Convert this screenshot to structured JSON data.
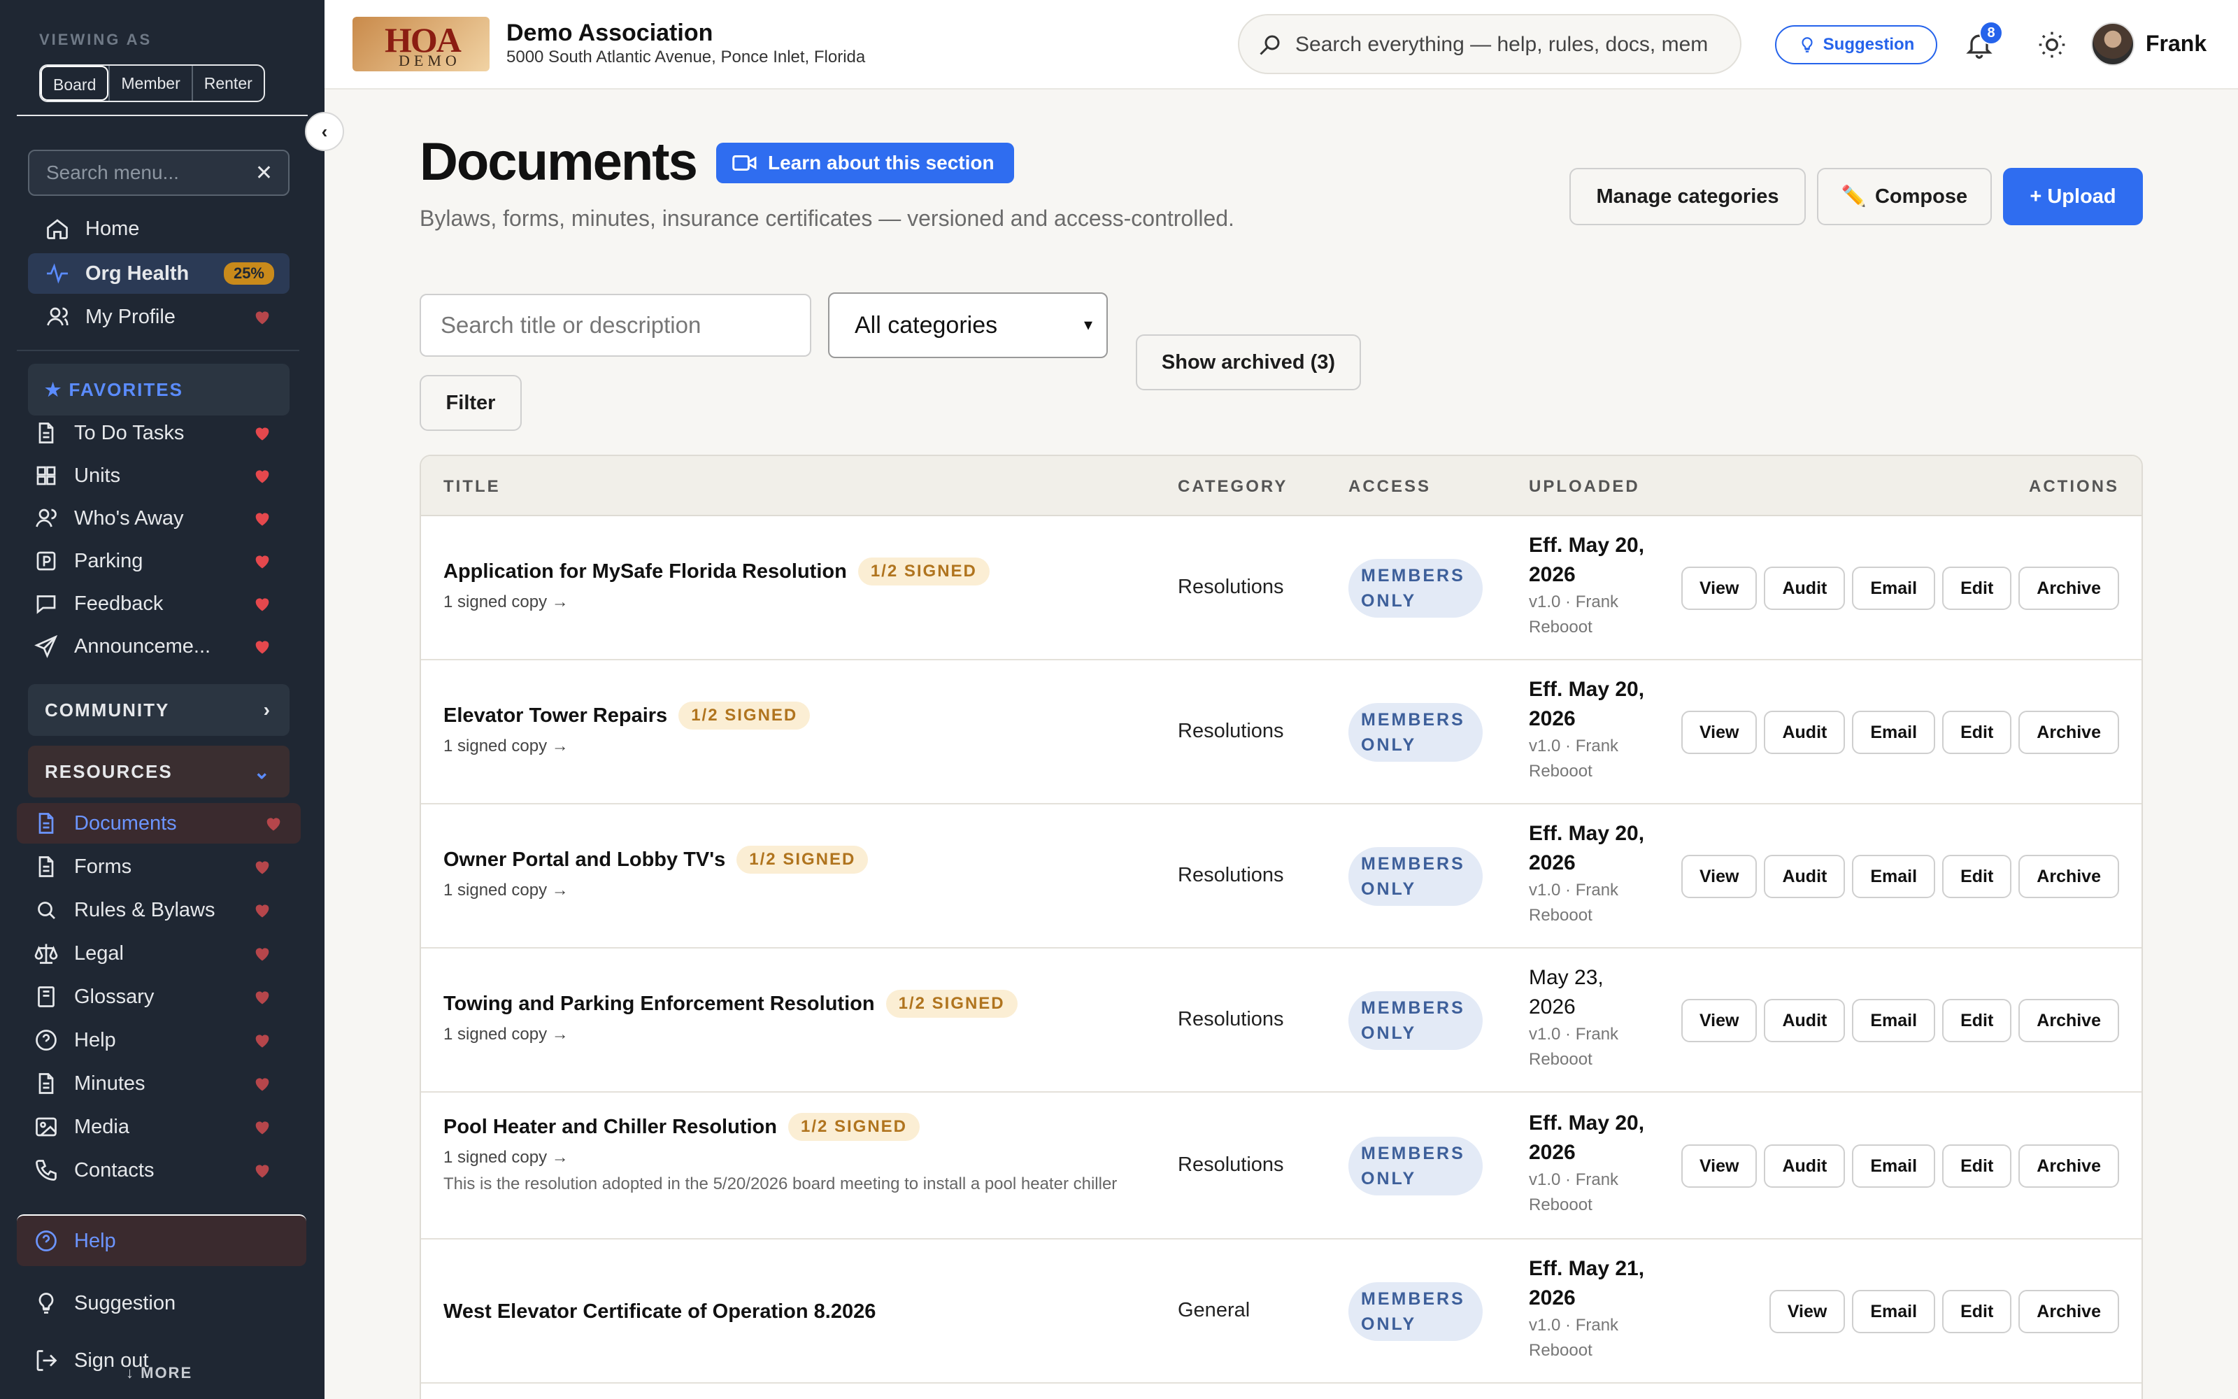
{
  "sidebar": {
    "viewing_as_label": "VIEWING AS",
    "roles": [
      "Board",
      "Member",
      "Renter"
    ],
    "search_placeholder": "Search menu...",
    "main_items": [
      {
        "label": "Home",
        "icon": "home-icon"
      },
      {
        "label": "Org Health",
        "icon": "pulse-icon",
        "badge": "25%"
      },
      {
        "label": "My Profile",
        "icon": "user-icon"
      }
    ],
    "favorites_label": "FAVORITES",
    "favorites": [
      {
        "label": "To Do Tasks",
        "icon": "document-icon"
      },
      {
        "label": "Units",
        "icon": "grid-icon"
      },
      {
        "label": "Who's Away",
        "icon": "users-icon"
      },
      {
        "label": "Parking",
        "icon": "parking-icon"
      },
      {
        "label": "Feedback",
        "icon": "chat-icon"
      },
      {
        "label": "Announceme...",
        "icon": "send-icon"
      }
    ],
    "community_label": "COMMUNITY",
    "resources_label": "RESOURCES",
    "resources": [
      {
        "label": "Documents",
        "icon": "document-icon"
      },
      {
        "label": "Forms",
        "icon": "document-icon"
      },
      {
        "label": "Rules & Bylaws",
        "icon": "search-icon"
      },
      {
        "label": "Legal",
        "icon": "scale-icon"
      },
      {
        "label": "Glossary",
        "icon": "book-icon"
      },
      {
        "label": "Help",
        "icon": "help-icon"
      },
      {
        "label": "Minutes",
        "icon": "document-icon"
      },
      {
        "label": "Media",
        "icon": "image-icon"
      },
      {
        "label": "Contacts",
        "icon": "phone-icon"
      }
    ],
    "bottom": {
      "help": "Help",
      "suggestion": "Suggestion",
      "sign_out": "Sign out",
      "more": "↓ MORE"
    }
  },
  "header": {
    "logo_top": "HOA",
    "logo_bottom": "DEMO",
    "org_name": "Demo Association",
    "org_address": "5000 South Atlantic Avenue, Ponce Inlet, Florida",
    "search_placeholder": "Search everything — help, rules, docs, members",
    "suggestion_label": "Suggestion",
    "notification_count": "8",
    "user_name": "Frank"
  },
  "page": {
    "title": "Documents",
    "learn_label": "Learn about this section",
    "subtitle": "Bylaws, forms, minutes, insurance certificates — versioned and access-controlled.",
    "buttons": {
      "manage": "Manage categories",
      "compose": "Compose",
      "upload": "+ Upload"
    },
    "filters": {
      "search_placeholder": "Search title or description",
      "category_value": "All categories",
      "show_archived": "Show archived (3)",
      "filter": "Filter"
    }
  },
  "table": {
    "columns": {
      "title": "TITLE",
      "category": "CATEGORY",
      "access": "ACCESS",
      "uploaded": "UPLOADED",
      "actions": "ACTIONS"
    },
    "rows": [
      {
        "title": "Application for MySafe Florida Resolution",
        "signed": "1/2 SIGNED",
        "sub": "1 signed copy →",
        "desc": "",
        "category": "Resolutions",
        "access": "MEMBERS ONLY",
        "date_line1": "Eff. May 20,",
        "date_line2": "2026",
        "meta1": "v1.0 · Frank",
        "meta2": "Rebooot",
        "actions": [
          "View",
          "Audit",
          "Email",
          "Edit",
          "Archive"
        ]
      },
      {
        "title": "Elevator Tower Repairs",
        "signed": "1/2 SIGNED",
        "sub": "1 signed copy →",
        "desc": "",
        "category": "Resolutions",
        "access": "MEMBERS ONLY",
        "date_line1": "Eff. May 20,",
        "date_line2": "2026",
        "meta1": "v1.0 · Frank",
        "meta2": "Rebooot",
        "actions": [
          "View",
          "Audit",
          "Email",
          "Edit",
          "Archive"
        ]
      },
      {
        "title": "Owner Portal and Lobby TV's",
        "signed": "1/2 SIGNED",
        "sub": "1 signed copy →",
        "desc": "",
        "category": "Resolutions",
        "access": "MEMBERS ONLY",
        "date_line1": "Eff. May 20,",
        "date_line2": "2026",
        "meta1": "v1.0 · Frank",
        "meta2": "Rebooot",
        "actions": [
          "View",
          "Audit",
          "Email",
          "Edit",
          "Archive"
        ]
      },
      {
        "title": "Towing and Parking Enforcement Resolution",
        "signed": "1/2 SIGNED",
        "sub": "1 signed copy →",
        "desc": "",
        "category": "Resolutions",
        "access": "MEMBERS ONLY",
        "date_line1": "May 23,",
        "date_line2": "2026",
        "meta1": "v1.0 · Frank",
        "meta2": "Rebooot",
        "actions": [
          "View",
          "Audit",
          "Email",
          "Edit",
          "Archive"
        ]
      },
      {
        "title": "Pool Heater and Chiller Resolution",
        "signed": "1/2 SIGNED",
        "sub": "1 signed copy →",
        "desc": "This is the resolution adopted in the 5/20/2026 board meeting to install a pool heater chiller",
        "category": "Resolutions",
        "access": "MEMBERS ONLY",
        "date_line1": "Eff. May 20,",
        "date_line2": "2026",
        "meta1": "v1.0 · Frank",
        "meta2": "Rebooot",
        "actions": [
          "View",
          "Audit",
          "Email",
          "Edit",
          "Archive"
        ]
      },
      {
        "title": "West Elevator Certificate of Operation 8.2026",
        "signed": "",
        "sub": "",
        "desc": "",
        "category": "General",
        "access": "MEMBERS ONLY",
        "date_line1": "Eff. May 21,",
        "date_line2": "2026",
        "meta1": "v1.0 · Frank",
        "meta2": "Rebooot",
        "actions": [
          "View",
          "Email",
          "Edit",
          "Archive"
        ]
      }
    ]
  },
  "colors": {
    "sidebar_bg": "#1f2733",
    "accent": "#2f6df0",
    "heart": "#e5484d",
    "pill_bg": "#fbeed4",
    "pill_fg": "#b0741e"
  }
}
